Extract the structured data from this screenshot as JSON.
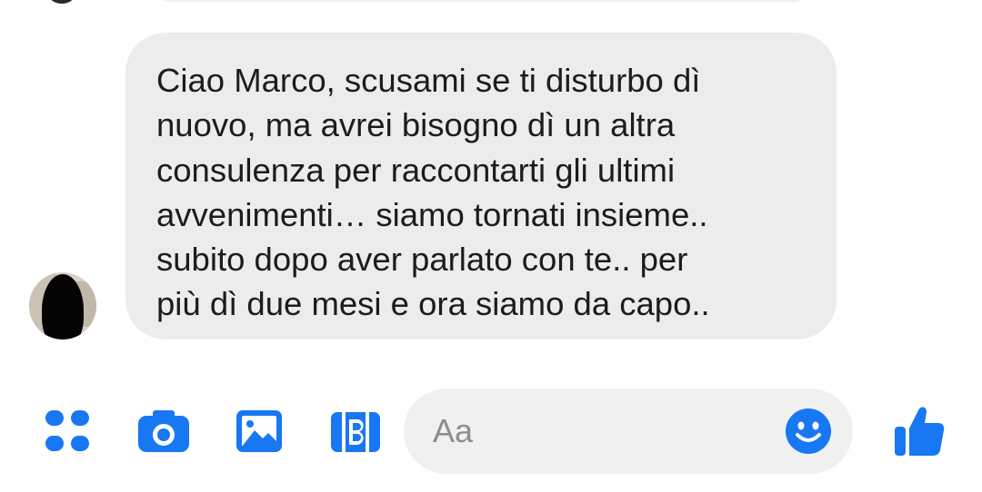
{
  "conversation": {
    "message": {
      "text": "Ciao Marco, scusami se ti disturbo dì\nnuovo, ma avrei bisogno dì un altra\nconsulenza per raccontarti gli ultimi\navvenimenti… siamo tornati insieme..\nsubito dopo aver parlato con te.. per\npiù dì due mesi e ora siamo da capo..",
      "direction": "received"
    }
  },
  "composer": {
    "placeholder": "Aa",
    "value": "",
    "icons": [
      "more-apps-icon",
      "camera-icon",
      "gallery-icon",
      "gif-sticker-icon",
      "emoji-icon",
      "thumbs-up-icon"
    ]
  },
  "colors": {
    "accent": "#1877f2",
    "bubble_received": "#ececec",
    "composer_bg": "#f0f0f0",
    "text": "#1c1c1c",
    "placeholder": "#8d8d8d"
  }
}
